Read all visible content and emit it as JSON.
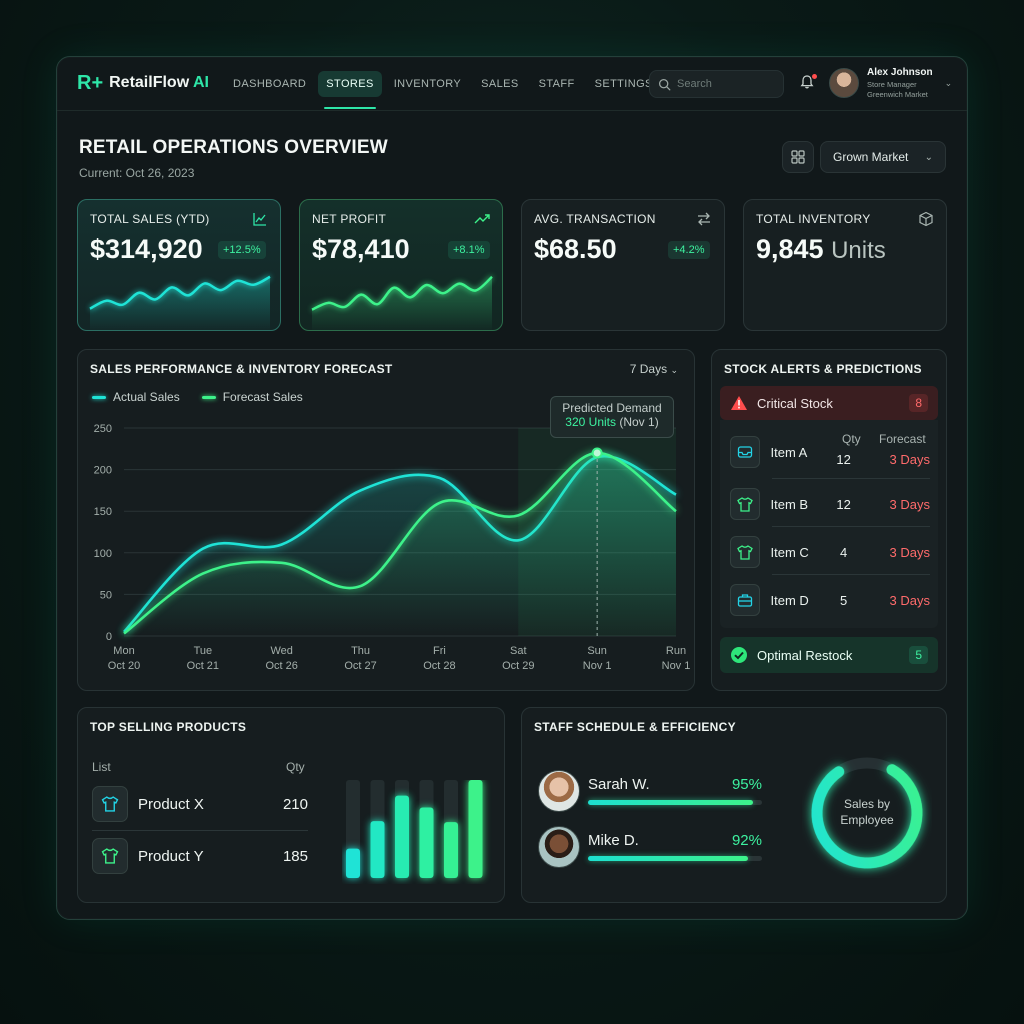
{
  "app": {
    "logo_mark": "R+",
    "name": "RetailFlow",
    "name_suffix": "AI"
  },
  "nav": {
    "items": [
      "DASHBOARD",
      "STORES",
      "INVENTORY",
      "SALES",
      "STAFF",
      "SETTINGS"
    ],
    "active": "STORES"
  },
  "search": {
    "placeholder": "Search"
  },
  "user": {
    "name": "Alex Johnson",
    "role": "Store Manager",
    "location": "Greenwich Market"
  },
  "header": {
    "title": "RETAIL OPERATIONS OVERVIEW",
    "subtitle": "Current: Oct 26, 2023",
    "market_select": "Grown Market"
  },
  "kpis": [
    {
      "label": "TOTAL SALES (YTD)",
      "value": "$314,920",
      "badge": "+12.5%",
      "icon": "line-chart-icon",
      "spark": [
        20,
        32,
        26,
        44,
        34,
        52,
        40,
        58,
        48,
        62,
        56,
        68
      ]
    },
    {
      "label": "NET PROFIT",
      "value": "$78,410",
      "badge": "+8.1%",
      "icon": "trending-up-icon",
      "spark": [
        18,
        28,
        22,
        40,
        26,
        50,
        36,
        54,
        42,
        56,
        46,
        66
      ]
    },
    {
      "label": "AVG. TRANSACTION",
      "value": "$68.50",
      "badge": "+4.2%",
      "icon": "arrows-exchange-icon"
    },
    {
      "label": "TOTAL INVENTORY",
      "value": "9,845",
      "unit": "Units",
      "icon": "cube-icon"
    }
  ],
  "forecast": {
    "title": "SALES PERFORMANCE & INVENTORY FORECAST",
    "range": "7 Days",
    "tooltip_title": "Predicted Demand",
    "tooltip_value": "320 Units",
    "tooltip_date": "(Nov 1)"
  },
  "chart_data": {
    "type": "line",
    "x_days": [
      "Mon",
      "Tue",
      "Wed",
      "Thu",
      "Fri",
      "Sat",
      "Sun",
      "Run"
    ],
    "x_dates": [
      "Oct 20",
      "Oct 21",
      "Oct 26",
      "Oct 27",
      "Oct 28",
      "Oct 29",
      "Nov 1",
      "Nov 1"
    ],
    "ylim": [
      0,
      250
    ],
    "yticks": [
      0,
      50,
      100,
      150,
      200,
      250
    ],
    "series": [
      {
        "name": "Actual Sales",
        "color": "#1fe3d6",
        "values": [
          5,
          105,
          110,
          175,
          190,
          115,
          215,
          170
        ]
      },
      {
        "name": "Forecast Sales",
        "color": "#3df28a",
        "values": [
          3,
          75,
          88,
          60,
          160,
          145,
          220,
          150
        ]
      }
    ],
    "highlight_index": 6,
    "forecast_region_start": 5
  },
  "stock_alerts": {
    "title": "STOCK ALERTS & PREDICTIONS",
    "critical_label": "Critical Stock",
    "critical_count": "8",
    "col_qty": "Qty",
    "col_forecast": "Forecast",
    "items": [
      {
        "name": "Item A",
        "qty": "12",
        "forecast": "3 Days",
        "icon": "inbox-icon"
      },
      {
        "name": "Item B",
        "qty": "12",
        "forecast": "3 Days",
        "icon": "shirt-icon"
      },
      {
        "name": "Item C",
        "qty": "4",
        "forecast": "3 Days",
        "icon": "shirt-icon"
      },
      {
        "name": "Item D",
        "qty": "5",
        "forecast": "3 Days",
        "icon": "toolbox-icon"
      }
    ],
    "optimal_label": "Optimal Restock",
    "optimal_count": "5"
  },
  "top_selling": {
    "title": "TOP SELLING PRODUCTS",
    "col_list": "List",
    "col_qty": "Qty",
    "products": [
      {
        "name": "Product X",
        "qty": "210",
        "icon": "shirt-icon"
      },
      {
        "name": "Product Y",
        "qty": "185",
        "icon": "shirt-icon"
      }
    ],
    "bars": [
      0.3,
      0.58,
      0.84,
      0.72,
      0.57,
      1.0
    ],
    "bar_colors": [
      "#1fe3d6",
      "#22e8c4",
      "#27ecb2",
      "#2ef0a2",
      "#35f194",
      "#3df28a"
    ]
  },
  "staff": {
    "title": "STAFF SCHEDULE & EFFICIENCY",
    "members": [
      {
        "name": "Sarah W.",
        "pct": "95%",
        "value": 0.95
      },
      {
        "name": "Mike D.",
        "pct": "92%",
        "value": 0.92
      }
    ],
    "donut_label_1": "Sales by",
    "donut_label_2": "Employee",
    "donut_fraction": 0.82
  }
}
